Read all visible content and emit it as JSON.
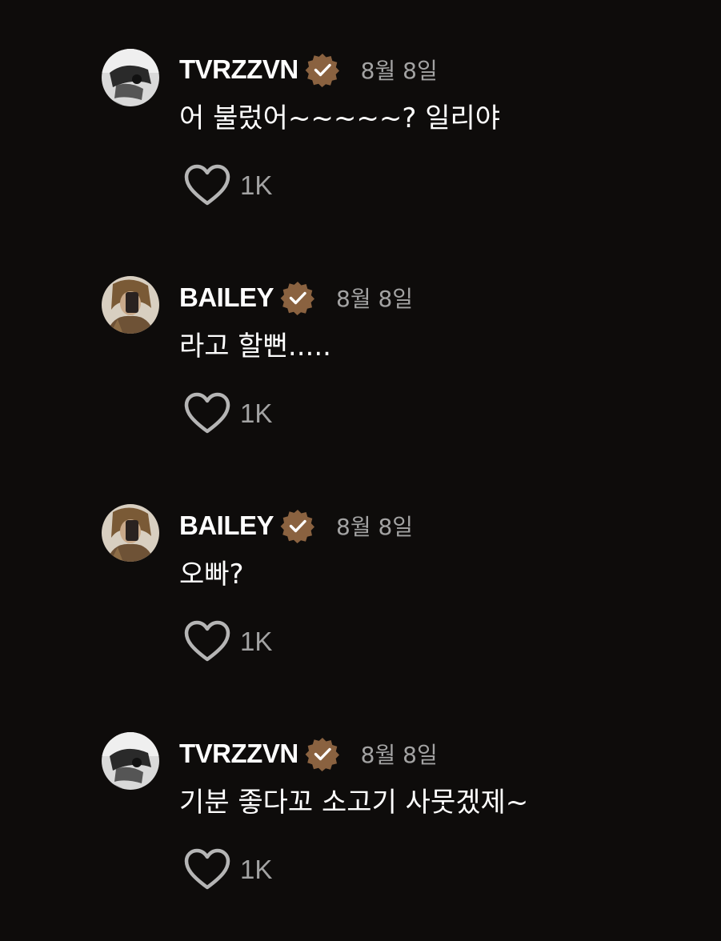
{
  "colors": {
    "background": "#0e0c0b",
    "badge": "#8a6240",
    "secondary_text": "#a3a3a3"
  },
  "comments": [
    {
      "username": "TVRZZVN",
      "verified_icon": "verified-badge-icon",
      "date": "8월 8일",
      "text": "어 불렀어~~~~~? 일리야",
      "likes": "1K"
    },
    {
      "username": "BAILEY",
      "verified_icon": "verified-badge-icon",
      "date": "8월 8일",
      "text": "라고 할뻔.....",
      "likes": "1K"
    },
    {
      "username": "BAILEY",
      "verified_icon": "verified-badge-icon",
      "date": "8월 8일",
      "text": "오빠?",
      "likes": "1K"
    },
    {
      "username": "TVRZZVN",
      "verified_icon": "verified-badge-icon",
      "date": "8월 8일",
      "text": "기분 좋다꼬 소고기 사뭇겠제~",
      "likes": "1K"
    }
  ]
}
